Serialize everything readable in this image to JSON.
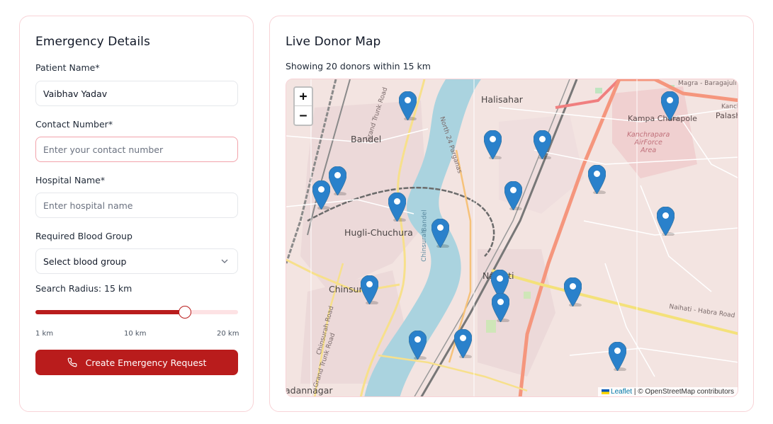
{
  "emergency": {
    "title": "Emergency Details",
    "patient_label": "Patient Name*",
    "patient_value": "Vaibhav Yadav",
    "contact_label": "Contact Number*",
    "contact_placeholder": "Enter your contact number",
    "hospital_label": "Hospital Name*",
    "hospital_placeholder": "Enter hospital name",
    "blood_label": "Required Blood Group",
    "blood_selected": "Select blood group",
    "radius_label": "Search Radius: 15 km",
    "radius_value_km": 15,
    "radius_min_km": 1,
    "radius_max_km": 20,
    "tick_labels": [
      "1 km",
      "10 km",
      "20 km"
    ],
    "submit_label": "Create Emergency Request",
    "accent_color": "#b91c1c"
  },
  "map_panel": {
    "title": "Live Donor Map",
    "summary": "Showing 20 donors within 15 km",
    "zoom_in": "+",
    "zoom_out": "−",
    "attribution_link": "Leaflet",
    "attribution_text": "| © OpenStreetMap contributors",
    "labels": {
      "halisahar": "Halisahar",
      "bandel": "Bandel",
      "hugli": "Hugli-Chuchura",
      "chinsurah": "Chinsurah",
      "naihati": "Naihati",
      "kampa": "Kampa Charapole",
      "kanchrapara": "Kanchrapara\nAirForce\nArea",
      "palashi": "Palashi",
      "magra": "Magra - Baragajuli Road",
      "kanch": "Kanch",
      "grand_trunk": "Grand Trunk Road",
      "naihati_habra": "Naihati - Habra Road",
      "chinsurah_road": "Chinsurah Road",
      "grand_trunk_2": "Grand Trunk Road",
      "north24": "North 24 Parganas",
      "chinsurah_river": "Chinsurah",
      "bandel_south": "Bandel",
      "dannagar": "adannagar"
    },
    "marker_color": "#2a81cb"
  }
}
